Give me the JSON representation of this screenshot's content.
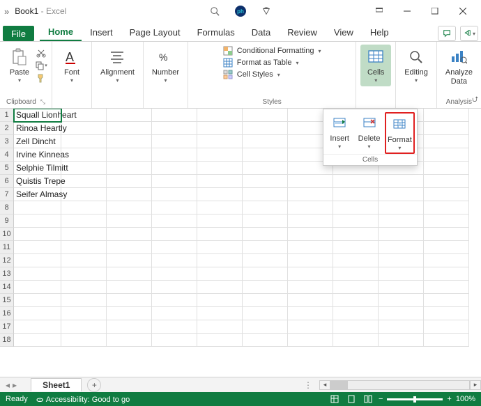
{
  "titlebar": {
    "doc_name": "Book1",
    "app_name": "Excel"
  },
  "tabs": {
    "file": "File",
    "home": "Home",
    "insert": "Insert",
    "page_layout": "Page Layout",
    "formulas": "Formulas",
    "data": "Data",
    "review": "Review",
    "view": "View",
    "help": "Help"
  },
  "ribbon": {
    "clipboard": {
      "paste": "Paste",
      "label": "Clipboard"
    },
    "font": {
      "label": "Font"
    },
    "alignment": {
      "label": "Alignment"
    },
    "number": {
      "label": "Number"
    },
    "styles": {
      "conditional": "Conditional Formatting",
      "table": "Format as Table",
      "cell_styles": "Cell Styles",
      "label": "Styles"
    },
    "cells": {
      "label": "Cells"
    },
    "editing": {
      "label": "Editing"
    },
    "analysis": {
      "label_line1": "Analyze",
      "label_line2": "Data",
      "group": "Analysis"
    }
  },
  "cells_popup": {
    "insert": "Insert",
    "delete": "Delete",
    "format": "Format",
    "group": "Cells"
  },
  "cells_a": [
    "Squall Lionheart",
    "Rinoa Heartly",
    "Zell Dincht",
    "Irvine Kinneas",
    "Selphie Tilmitt",
    "Quistis Trepe",
    "Seifer Almasy"
  ],
  "row_numbers": [
    "1",
    "2",
    "3",
    "4",
    "5",
    "6",
    "7",
    "8",
    "9",
    "10",
    "11",
    "12",
    "13",
    "14",
    "15",
    "16",
    "17",
    "18"
  ],
  "sheet": {
    "name": "Sheet1"
  },
  "status": {
    "ready": "Ready",
    "accessibility": "Accessibility: Good to go",
    "zoom": "100%"
  }
}
